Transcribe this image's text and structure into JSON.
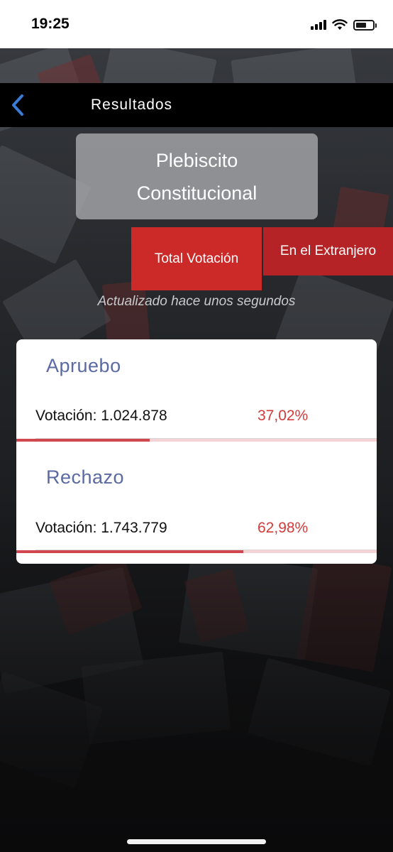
{
  "status_bar": {
    "time": "19:25"
  },
  "nav": {
    "title": "Resultados",
    "back_icon": "chevron-left-icon"
  },
  "election": {
    "line1": "Plebiscito",
    "line2": "Constitucional"
  },
  "tabs": [
    {
      "label": "Total Votación",
      "selected": true
    },
    {
      "label": "En el Extranjero",
      "selected": false
    }
  ],
  "updated_text": "Actualizado hace unos segundos",
  "results": [
    {
      "option": "Apruebo",
      "votes_label": "Votación: 1.024.878",
      "percent_label": "37,02%",
      "percent": 37.02
    },
    {
      "option": "Rechazo",
      "votes_label": "Votación: 1.743.779",
      "percent_label": "62,98%",
      "percent": 62.98
    }
  ],
  "colors": {
    "accent_red": "#cc2929",
    "option_blue": "#5b6aa3",
    "percent_red": "#d33a3a",
    "back_blue": "#3a7bd5"
  }
}
